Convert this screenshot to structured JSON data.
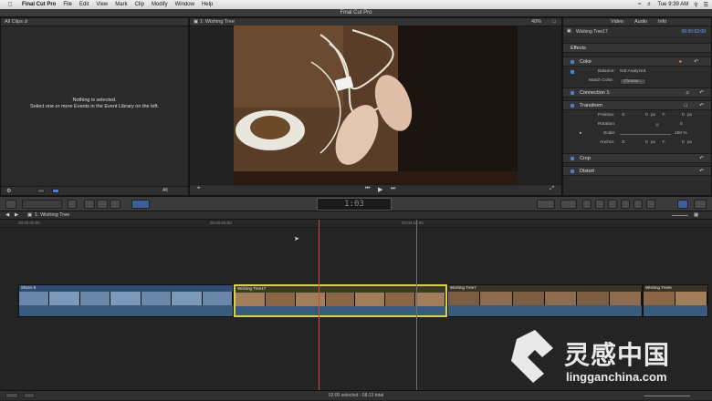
{
  "menubar": {
    "app": "Final Cut Pro",
    "items": [
      "File",
      "Edit",
      "View",
      "Mark",
      "Clip",
      "Modify",
      "Window",
      "Help"
    ],
    "clock": "Tue 9:39 AM"
  },
  "window": {
    "title": "Final Cut Pro"
  },
  "browser": {
    "header": "All Clips",
    "empty_line1": "Nothing is selected.",
    "empty_line2": "Select one or more Events in the Event Library on the left.",
    "footer_label": "All"
  },
  "viewer": {
    "header": "1: Wishing Tree",
    "zoom": "40%"
  },
  "inspector": {
    "tabs": [
      "Video",
      "Audio",
      "Info"
    ],
    "clip_name": "Wishing Tree17",
    "clip_timecode": "00:00:02:00",
    "effects_label": "Effects",
    "color_label": "Color",
    "balance_label": "Balance:",
    "balance_value": "Not Analyzed",
    "match_color_label": "Match Color:",
    "choose_label": "Choose...",
    "connection_label": "Connection 1:",
    "transform_label": "Transform",
    "position_label": "Position:",
    "position_x": "0",
    "position_y": "0",
    "rotation_label": "Rotation:",
    "rotation_value": "0",
    "scale_label": "Scale:",
    "scale_value": "100 %",
    "anchor_label": "Anchor:",
    "anchor_x": "0",
    "anchor_y": "0",
    "unit_px": "px",
    "crop_label": "Crop",
    "distort_label": "Distort"
  },
  "toolbar": {
    "timecode": "1:03"
  },
  "timeline": {
    "project": "1: Wishing Tree",
    "ruler": [
      "00:00:00:00",
      "00:00:05:00",
      "00:00:10:00"
    ],
    "clips": [
      {
        "name": "Shims 8",
        "color": "#2f4d72"
      },
      {
        "name": "Wishing Tree17",
        "color": "#3a3a2c"
      },
      {
        "name": "Wishing Tree7",
        "color": "#3a3225"
      },
      {
        "name": "Wishing Tree5",
        "color": "#3a3225"
      }
    ]
  },
  "status": {
    "text": "02:00 selected - 08:13 total"
  },
  "watermark": {
    "chinese": "灵感中国",
    "url": "lingganchina.com"
  },
  "colors": {
    "selection": "#d7d440",
    "playhead": "#d9462e",
    "accent": "#4c7fd6"
  }
}
